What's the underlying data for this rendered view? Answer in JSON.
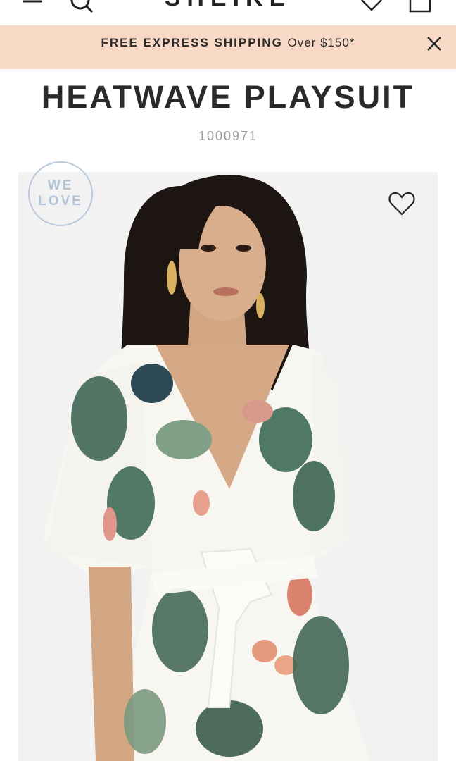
{
  "header": {
    "logo_text": "SHEIKE",
    "icons": [
      "menu-icon",
      "search-icon",
      "heart-icon",
      "bag-icon"
    ]
  },
  "promo": {
    "strong_text": "FREE EXPRESS SHIPPING",
    "light_text": "Over $150*",
    "close_icon": "close-icon",
    "background": "#f8d9c6"
  },
  "product": {
    "title": "HEATWAVE PLAYSUIT",
    "sku": "1000971",
    "badge": {
      "line1": "WE",
      "line2": "LOVE",
      "color": "#b3c3d7"
    },
    "wishlist_icon": "heart-outline-icon",
    "image_alt": "Model wearing white tropical floral print playsuit with tie front"
  }
}
